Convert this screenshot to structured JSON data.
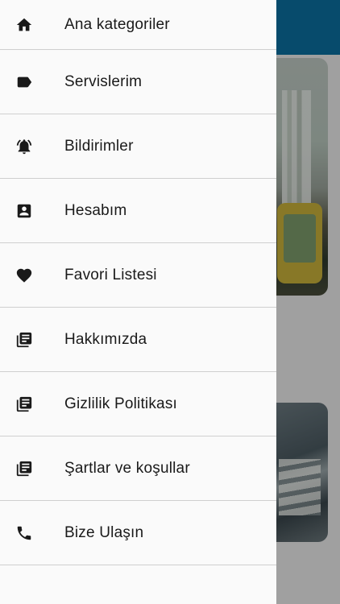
{
  "drawer": {
    "items": [
      {
        "label": "Ana kategoriler",
        "icon": "home-icon"
      },
      {
        "label": "Servislerim",
        "icon": "label-tag-icon"
      },
      {
        "label": "Bildirimler",
        "icon": "notification-bell-icon"
      },
      {
        "label": "Hesabım",
        "icon": "account-box-icon"
      },
      {
        "label": "Favori Listesi",
        "icon": "heart-icon"
      },
      {
        "label": "Hakkımızda",
        "icon": "library-books-icon"
      },
      {
        "label": "Gizlilik Politikası",
        "icon": "library-books-icon"
      },
      {
        "label": "Şartlar ve koşullar",
        "icon": "library-books-icon"
      },
      {
        "label": "Bize Ulaşın",
        "icon": "phone-icon"
      }
    ]
  },
  "colors": {
    "app_bar": "#0b6fa0",
    "drawer_bg": "#fafafa",
    "divider": "#cfcfcf",
    "text": "#1a1a1a",
    "icon": "#1a1a1a"
  }
}
